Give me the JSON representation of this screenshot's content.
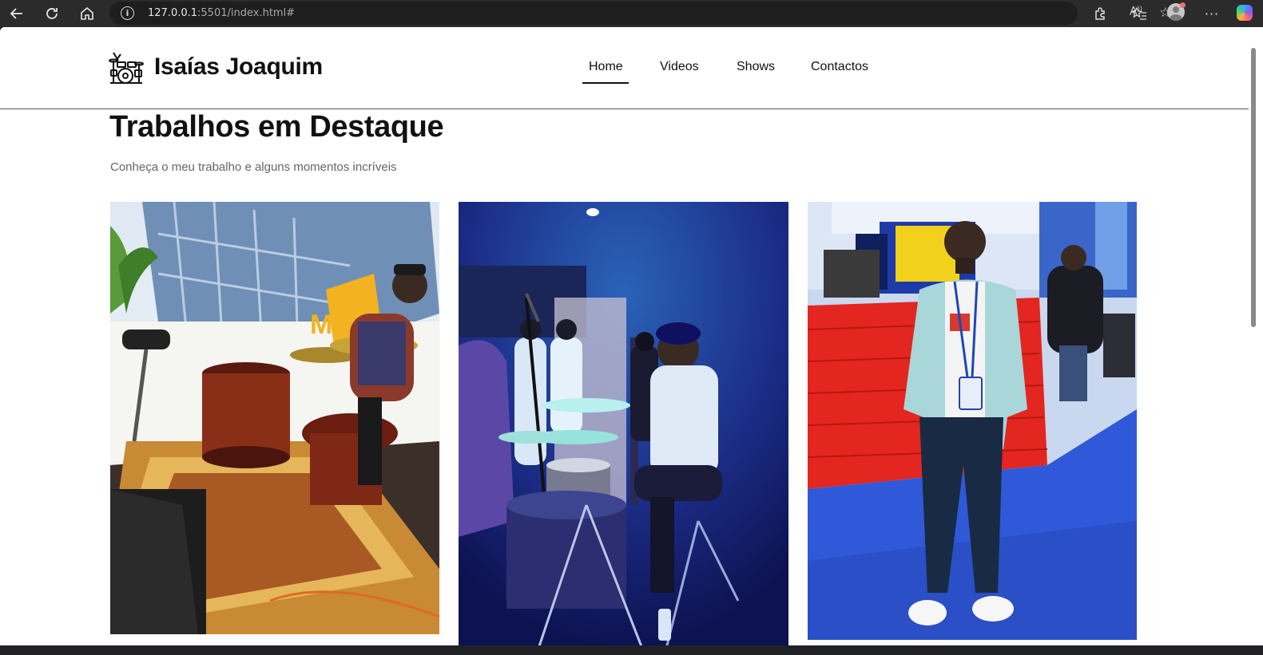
{
  "browser": {
    "url_host": "127.0.0.1",
    "url_rest": ":5501/index.html#",
    "icons": [
      "back-icon",
      "reload-icon",
      "home-icon",
      "site-info-icon",
      "read-aloud-icon",
      "favorite-star-icon",
      "extensions-icon",
      "favorites-icon",
      "profile-icon",
      "more-icon",
      "copilot-icon"
    ]
  },
  "header": {
    "logo_text": "Isaías Joaquim",
    "logo_icon": "drum-kit-icon",
    "nav": [
      "Home",
      "Videos",
      "Shows",
      "Contactos"
    ],
    "active_nav": "Home"
  },
  "featured": {
    "title": "Trabalhos em Destaque",
    "subtitle": "Conheça o meu trabalho e alguns momentos incríveis",
    "photos": [
      {
        "name": "drummer-outdoor-stage-photo"
      },
      {
        "name": "drummer-concert-stage-photo"
      },
      {
        "name": "portrait-event-hall-photo"
      }
    ]
  },
  "colors": {
    "text": "#111111",
    "subtitle": "#666666",
    "background": "#ffffff",
    "chrome": "#2b2b2b"
  }
}
